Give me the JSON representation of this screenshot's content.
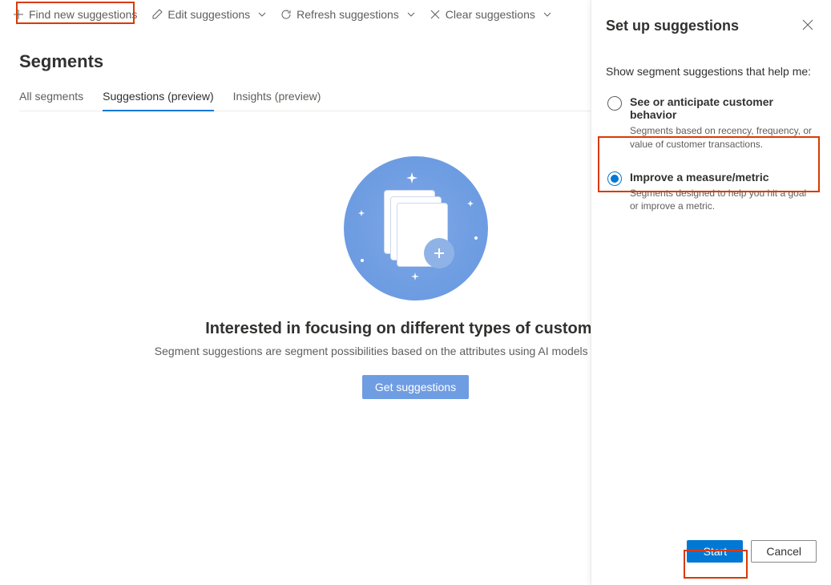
{
  "commandBar": {
    "find": "Find new suggestions",
    "edit": "Edit suggestions",
    "refresh": "Refresh suggestions",
    "clear": "Clear suggestions"
  },
  "pageTitle": "Segments",
  "tabs": [
    "All segments",
    "Suggestions (preview)",
    "Insights (preview)"
  ],
  "activeTabIndex": 1,
  "hero": {
    "title": "Interested in focusing on different types of customers?",
    "subtitle": "Segment suggestions are segment possibilities based on the attributes using AI models or based on activ",
    "cta": "Get suggestions"
  },
  "panel": {
    "title": "Set up suggestions",
    "instruction": "Show segment suggestions that help me:",
    "options": [
      {
        "title": "See or anticipate customer behavior",
        "desc": "Segments based on recency, frequency, or value of customer transactions.",
        "selected": false
      },
      {
        "title": "Improve a measure/metric",
        "desc": "Segments designed to help you hit a goal or improve a metric.",
        "selected": true
      }
    ],
    "startLabel": "Start",
    "cancelLabel": "Cancel"
  }
}
